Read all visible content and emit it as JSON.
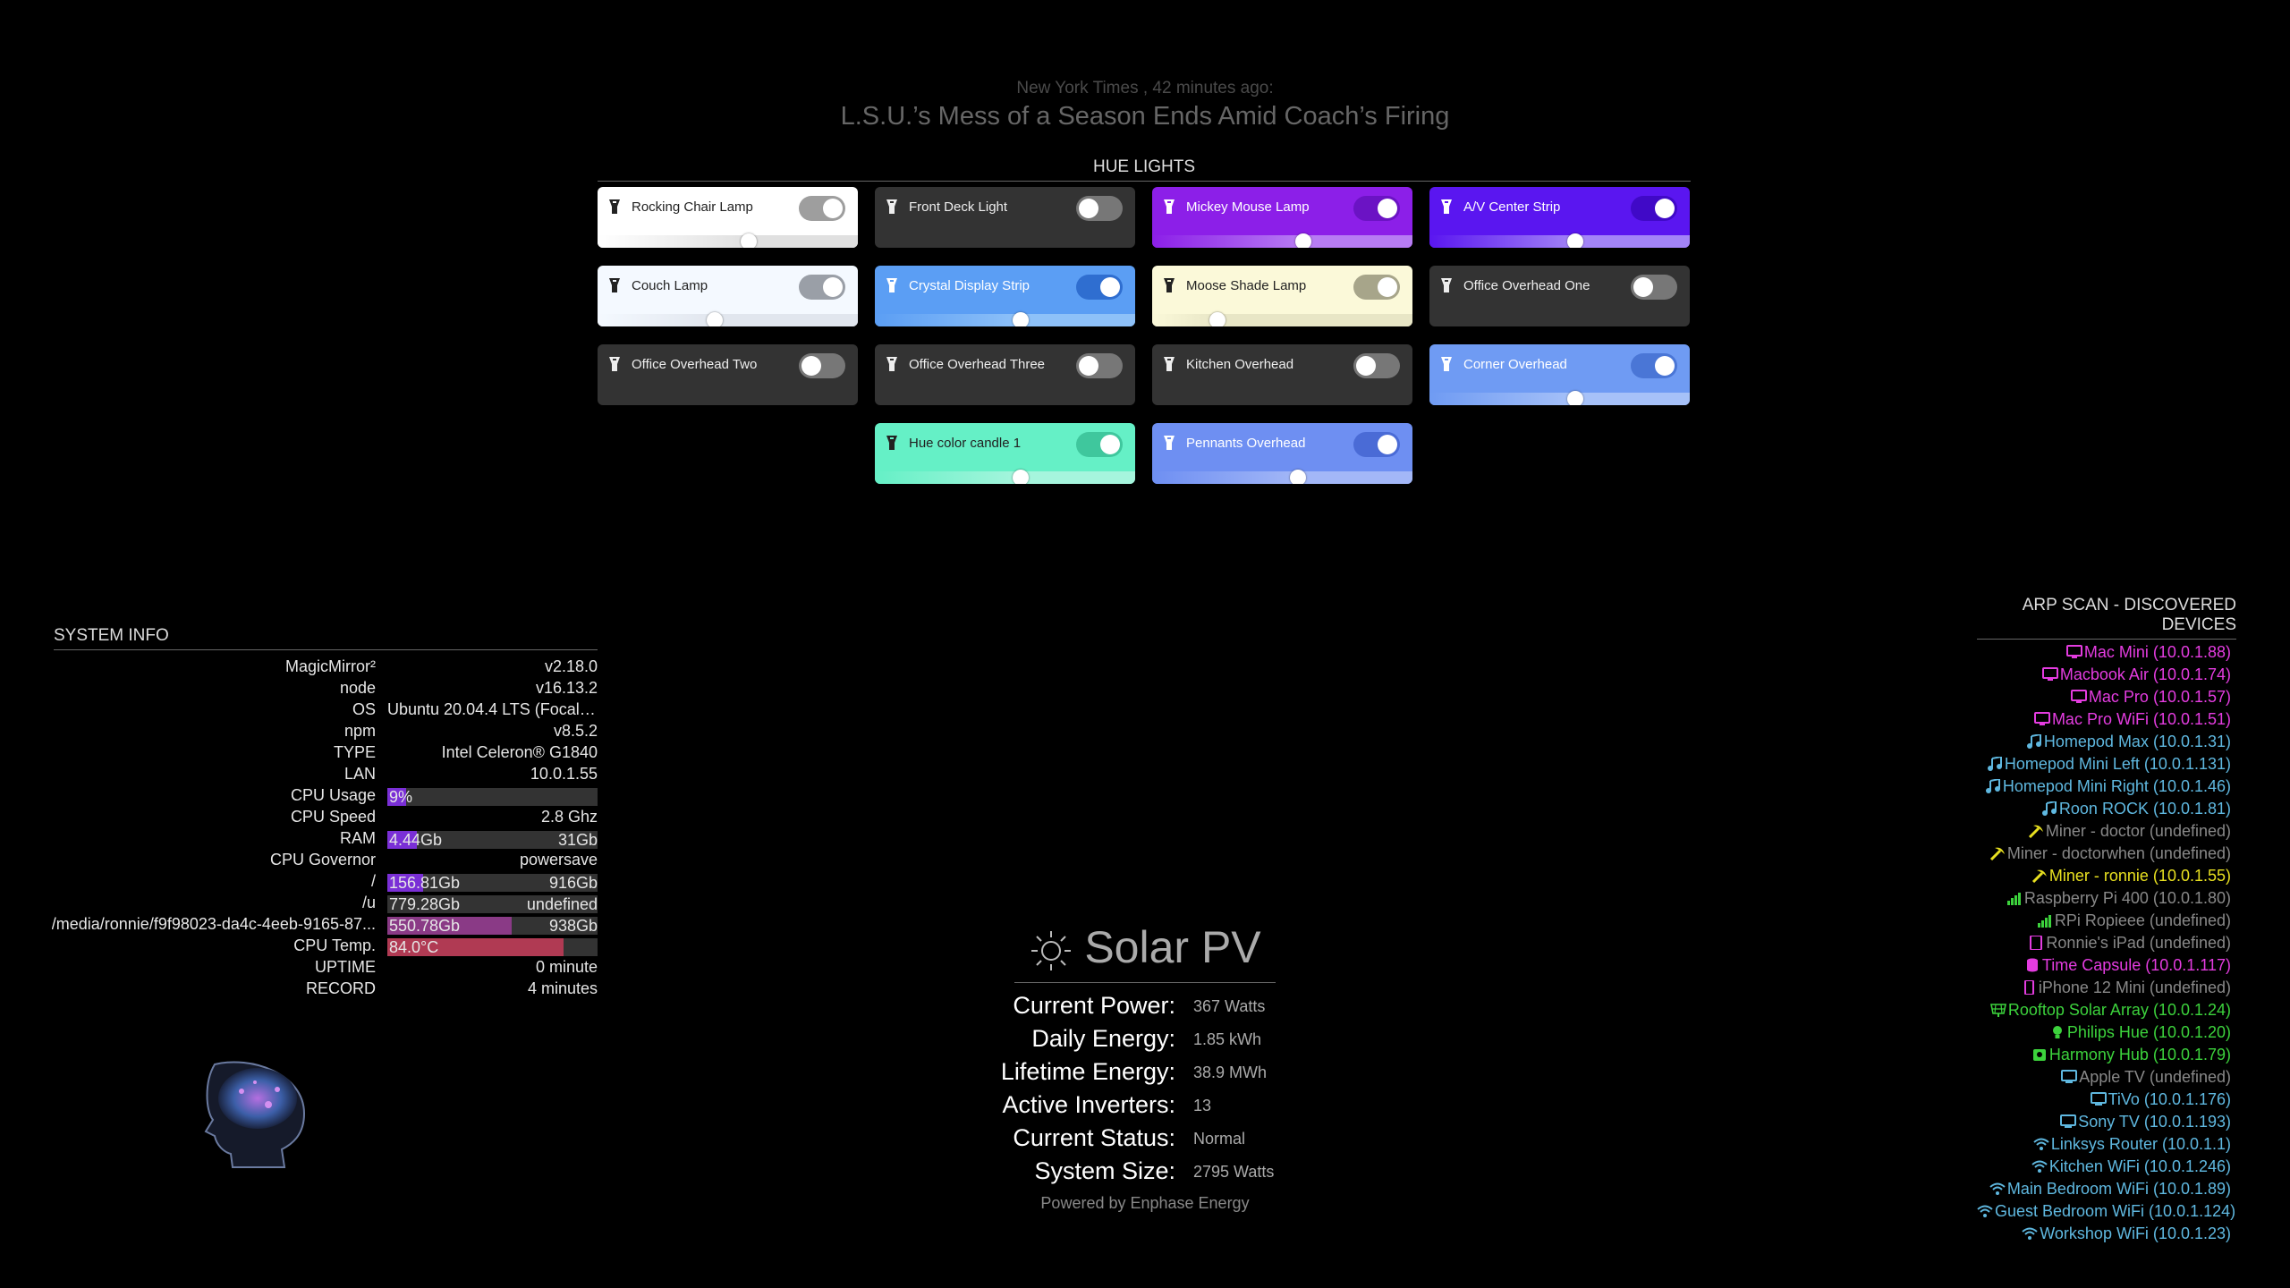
{
  "news": {
    "source": "New York Times , 42 minutes ago:",
    "headline": "L.S.U.’s Mess of a Season Ends Amid Coach’s Firing"
  },
  "hue": {
    "header": "HUE LIGHTS",
    "lights": [
      {
        "name": "Rocking Chair Lamp",
        "on": true,
        "brightness": 0.58,
        "bg": "#ffffff",
        "bar": "#e0e0e0",
        "text": "#222",
        "toggle": "#9e9e9e"
      },
      {
        "name": "Front Deck Light",
        "on": false,
        "brightness": null,
        "bg": "#333333",
        "bar": null,
        "text": "#eee",
        "toggle": "#777"
      },
      {
        "name": "Mickey Mouse Lamp",
        "on": true,
        "brightness": 0.58,
        "bg": "#8c1fe8",
        "bar": "#b77cf3",
        "text": "#fff",
        "toggle": "#6b13c4"
      },
      {
        "name": "A/V Center Strip",
        "on": true,
        "brightness": 0.56,
        "bg": "#5a16f0",
        "bar": "#a384f7",
        "text": "#fff",
        "toggle": "#4009c7"
      },
      {
        "name": "Couch Lamp",
        "on": true,
        "brightness": 0.45,
        "bg": "#f4f9ff",
        "bar": "#e1e6ee",
        "text": "#222",
        "toggle": "#9a9fa7"
      },
      {
        "name": "Crystal Display Strip",
        "on": true,
        "brightness": 0.56,
        "bg": "#5b9ef4",
        "bar": "#8ec1f8",
        "text": "#fff",
        "toggle": "#2f6ed0"
      },
      {
        "name": "Moose Shade Lamp",
        "on": true,
        "brightness": 0.25,
        "bg": "#fbf9d9",
        "bar": "#e8e6c6",
        "text": "#222",
        "toggle": "#a7a58a"
      },
      {
        "name": "Office Overhead One",
        "on": false,
        "brightness": null,
        "bg": "#333333",
        "bar": null,
        "text": "#eee",
        "toggle": "#777"
      },
      {
        "name": "Office Overhead Two",
        "on": false,
        "brightness": null,
        "bg": "#333333",
        "bar": null,
        "text": "#eee",
        "toggle": "#777"
      },
      {
        "name": "Office Overhead Three",
        "on": false,
        "brightness": null,
        "bg": "#333333",
        "bar": null,
        "text": "#eee",
        "toggle": "#777"
      },
      {
        "name": "Kitchen Overhead",
        "on": false,
        "brightness": null,
        "bg": "#333333",
        "bar": null,
        "text": "#eee",
        "toggle": "#777"
      },
      {
        "name": "Corner Overhead",
        "on": true,
        "brightness": 0.56,
        "bg": "#6f9bf3",
        "bar": "#a6c1f8",
        "text": "#fff",
        "toggle": "#4a76d6"
      },
      {
        "name": "Hue color candle 1",
        "on": true,
        "brightness": 0.56,
        "bg": "#65f0c6",
        "bar": "#a6f5dd",
        "text": "#222",
        "toggle": "#3fc79d"
      },
      {
        "name": "Pennants Overhead",
        "on": true,
        "brightness": 0.56,
        "bg": "#6e8ff2",
        "bar": "#a3b7f7",
        "text": "#fff",
        "toggle": "#4a6bd6"
      }
    ]
  },
  "system": {
    "header": "SYSTEM INFO",
    "rows": [
      {
        "label": "MagicMirror²",
        "value": "v2.18.0"
      },
      {
        "label": "node",
        "value": "v16.13.2"
      },
      {
        "label": "OS",
        "value": "Ubuntu 20.04.4 LTS (Focal F...",
        "align": "left"
      },
      {
        "label": "npm",
        "value": "v8.5.2"
      },
      {
        "label": "TYPE",
        "value": "Intel Celeron® G1840"
      },
      {
        "label": "LAN",
        "value": "10.0.1.55"
      },
      {
        "label": "CPU Usage",
        "bar": {
          "text": "9%",
          "total": "",
          "fraction": 0.09,
          "color": "#7a2fd6"
        }
      },
      {
        "label": "CPU Speed",
        "value": "2.8 Ghz"
      },
      {
        "label": "RAM",
        "bar": {
          "text": "4.44Gb",
          "total": "31Gb",
          "fraction": 0.14,
          "color": "#7a2fd6"
        }
      },
      {
        "label": "CPU Governor",
        "value": "powersave"
      },
      {
        "label": "/",
        "bar": {
          "text": "156.81Gb",
          "total": "916Gb",
          "fraction": 0.17,
          "color": "#7a2fd6"
        }
      },
      {
        "label": "/u",
        "bar": {
          "text": "779.28Gb",
          "total": "undefined",
          "fraction": 0.0,
          "color": "#7a2fd6"
        }
      },
      {
        "label": "/media/ronnie/f9f98023-da4c-4eeb-9165-87...",
        "bar": {
          "text": "550.78Gb",
          "total": "938Gb",
          "fraction": 0.59,
          "color": "#8a3a86"
        }
      },
      {
        "label": "CPU Temp.",
        "bar": {
          "text": "84.0°C",
          "total": "",
          "fraction": 0.84,
          "color": "#b03a53"
        }
      },
      {
        "label": "UPTIME",
        "value": "0 minute"
      },
      {
        "label": "RECORD",
        "value": "4 minutes"
      }
    ]
  },
  "solar": {
    "title": "Solar PV",
    "rows": [
      {
        "label": "Current Power:",
        "value": "367 Watts"
      },
      {
        "label": "Daily Energy:",
        "value": "1.85 kWh"
      },
      {
        "label": "Lifetime Energy:",
        "value": "38.9 MWh"
      },
      {
        "label": "Active Inverters:",
        "value": "13"
      },
      {
        "label": "Current Status:",
        "value": "Normal"
      },
      {
        "label": "System Size:",
        "value": "2795 Watts"
      }
    ],
    "powered_by": "Powered by Enphase Energy"
  },
  "arp": {
    "header": "ARP SCAN - DISCOVERED DEVICES",
    "devices": [
      {
        "text": "Mac Mini (10.0.1.88)",
        "color": "#e43ce0",
        "icon": "desktop-icon"
      },
      {
        "text": "Macbook Air (10.0.1.74)",
        "color": "#e43ce0",
        "icon": "desktop-icon"
      },
      {
        "text": "Mac Pro (10.0.1.57)",
        "color": "#e43ce0",
        "icon": "desktop-icon"
      },
      {
        "text": "Mac Pro WiFi (10.0.1.51)",
        "color": "#e43ce0",
        "icon": "desktop-icon"
      },
      {
        "text": "Homepod Max (10.0.1.31)",
        "color": "#5fb8e0",
        "icon": "music-icon"
      },
      {
        "text": "Homepod Mini Left (10.0.1.131)",
        "color": "#5fb8e0",
        "icon": "music-icon"
      },
      {
        "text": "Homepod Mini Right (10.0.1.46)",
        "color": "#5fb8e0",
        "icon": "music-icon"
      },
      {
        "text": "Roon ROCK (10.0.1.81)",
        "color": "#5fb8e0",
        "icon": "music-icon"
      },
      {
        "text": "Miner - doctor (undefined)",
        "color": "#888888",
        "icon": "pickaxe-icon",
        "iconColor": "#e8e020"
      },
      {
        "text": "Miner - doctorwhen (undefined)",
        "color": "#888888",
        "icon": "pickaxe-icon",
        "iconColor": "#e8e020"
      },
      {
        "text": "Miner - ronnie (10.0.1.55)",
        "color": "#e8e020",
        "icon": "pickaxe-icon"
      },
      {
        "text": "Raspberry Pi 400 (10.0.1.80)",
        "color": "#888888",
        "icon": "signal-icon",
        "iconColor": "#3cd23c"
      },
      {
        "text": "RPi Ropieee (undefined)",
        "color": "#888888",
        "icon": "signal-icon",
        "iconColor": "#3cd23c"
      },
      {
        "text": "Ronnie's iPad (undefined)",
        "color": "#888888",
        "icon": "tablet-icon",
        "iconColor": "#e43ce0"
      },
      {
        "text": "Time Capsule (10.0.1.117)",
        "color": "#e43ce0",
        "icon": "database-icon"
      },
      {
        "text": "iPhone 12 Mini (undefined)",
        "color": "#888888",
        "icon": "phone-icon",
        "iconColor": "#e43ce0"
      },
      {
        "text": "Rooftop Solar Array (10.0.1.24)",
        "color": "#3cd23c",
        "icon": "solar-panel-icon"
      },
      {
        "text": "Philips Hue (10.0.1.20)",
        "color": "#3cd23c",
        "icon": "lightbulb-icon"
      },
      {
        "text": "Harmony Hub (10.0.1.79)",
        "color": "#3cd23c",
        "icon": "remote-icon"
      },
      {
        "text": "Apple TV (undefined)",
        "color": "#888888",
        "icon": "tv-icon",
        "iconColor": "#5fb8e0"
      },
      {
        "text": "TiVo (10.0.1.176)",
        "color": "#5fb8e0",
        "icon": "tv-icon"
      },
      {
        "text": "Sony TV (10.0.1.193)",
        "color": "#5fb8e0",
        "icon": "tv-icon"
      },
      {
        "text": "Linksys Router (10.0.1.1)",
        "color": "#5fb8e0",
        "icon": "wifi-icon"
      },
      {
        "text": "Kitchen WiFi (10.0.1.246)",
        "color": "#5fb8e0",
        "icon": "wifi-icon"
      },
      {
        "text": "Main Bedroom WiFi (10.0.1.89)",
        "color": "#5fb8e0",
        "icon": "wifi-icon"
      },
      {
        "text": "Guest Bedroom WiFi (10.0.1.124)",
        "color": "#5fb8e0",
        "icon": "wifi-icon"
      },
      {
        "text": "Workshop WiFi (10.0.1.23)",
        "color": "#5fb8e0",
        "icon": "wifi-icon"
      }
    ]
  }
}
